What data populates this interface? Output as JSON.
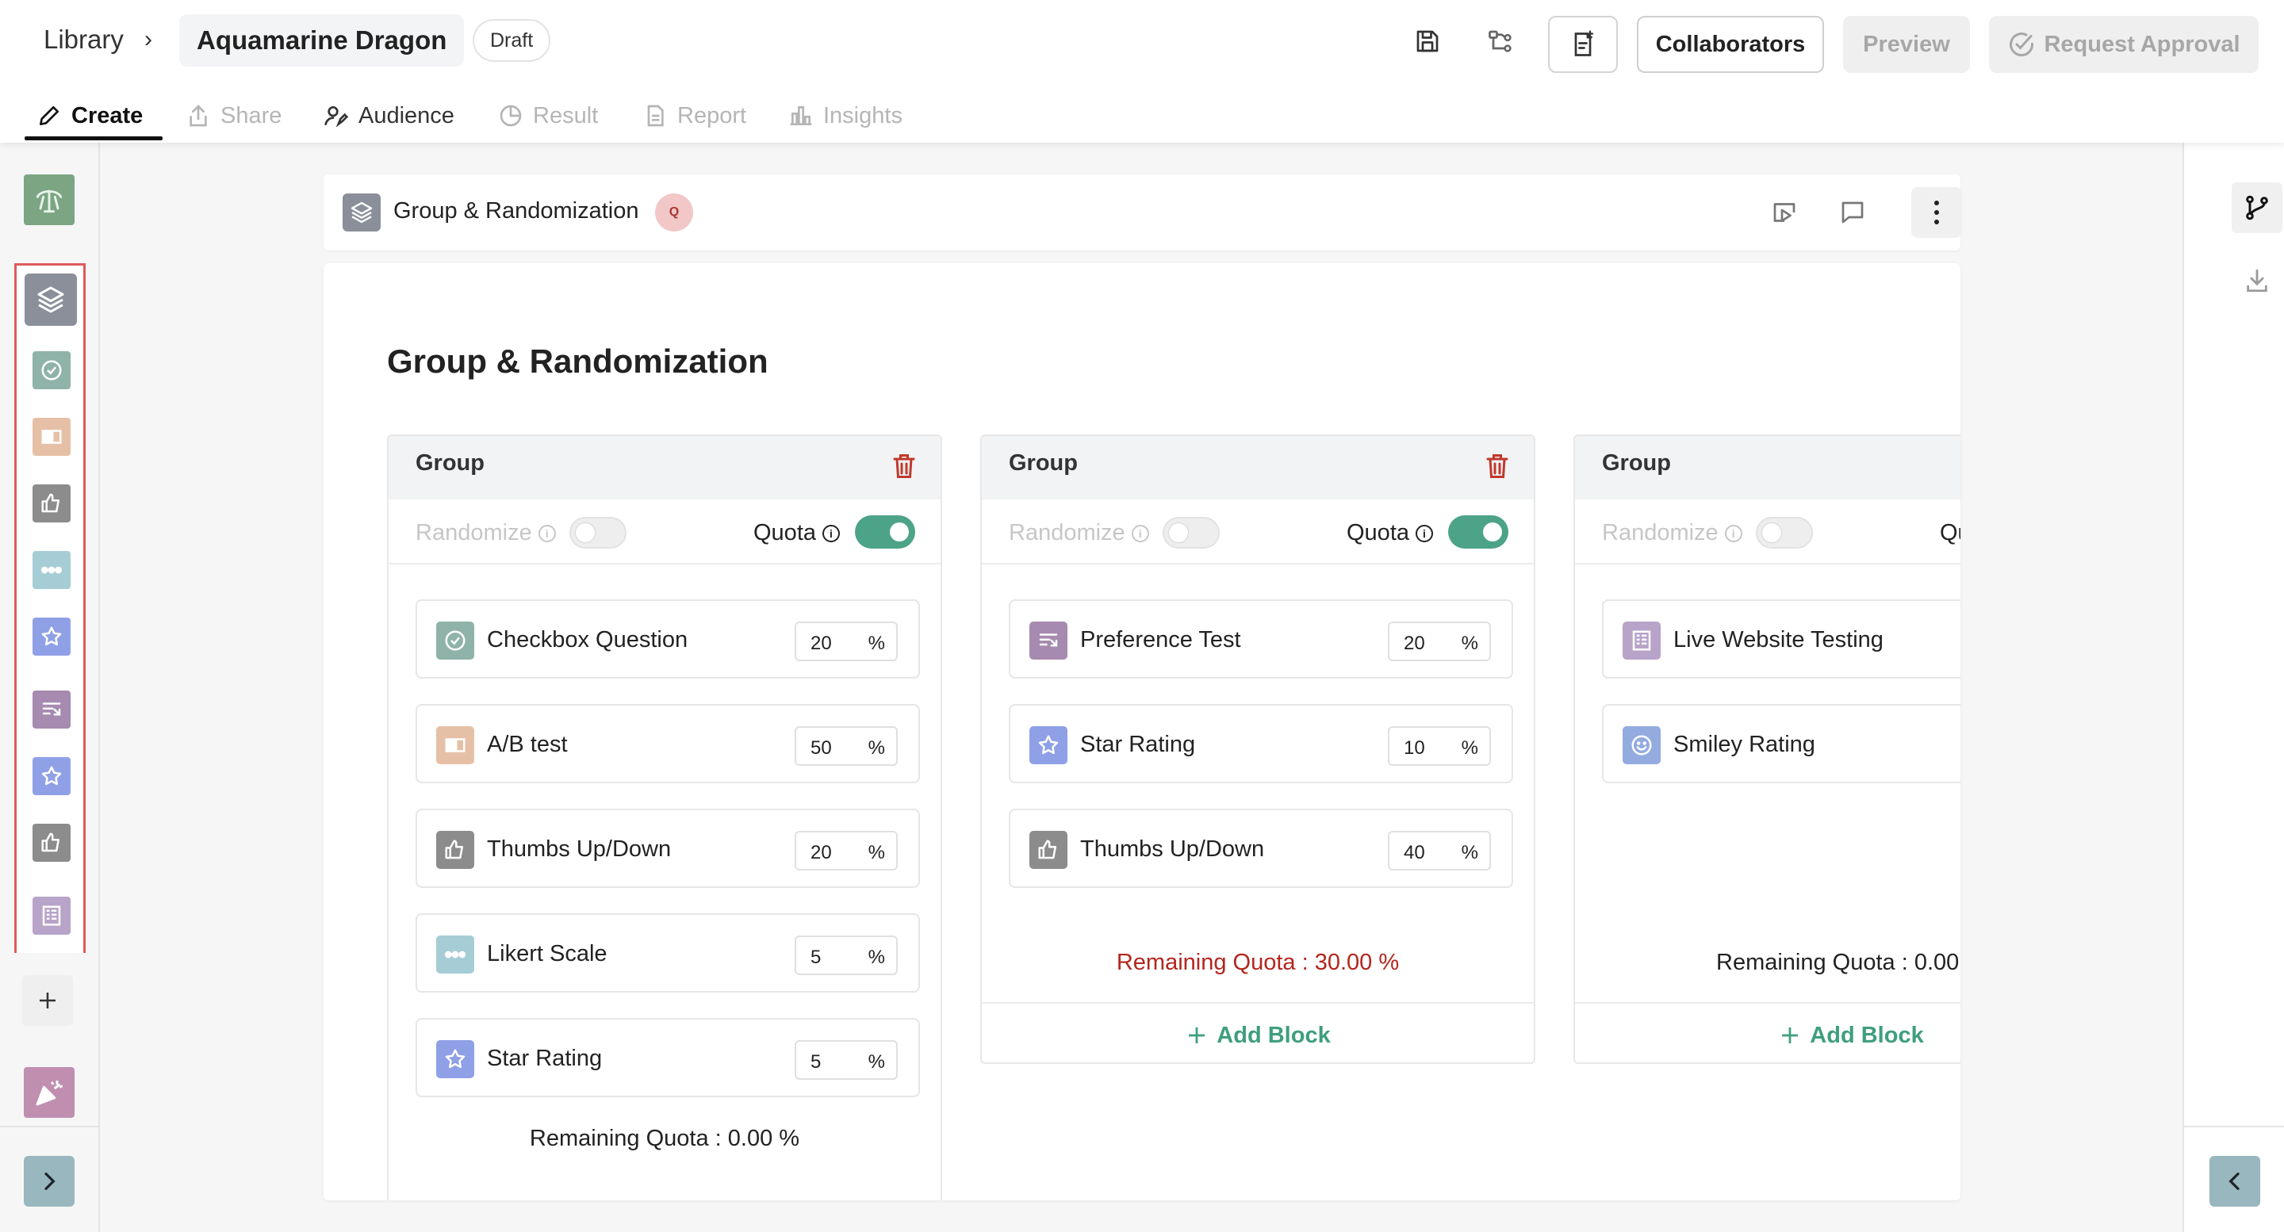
{
  "header": {
    "breadcrumb_library": "Library",
    "breadcrumb_separator": "›",
    "title": "Aquamarine Dragon",
    "status_badge": "Draft",
    "collaborators_label": "Collaborators",
    "preview_label": "Preview",
    "request_approval_label": "Request Approval"
  },
  "tabs": [
    {
      "label": "Create",
      "icon": "pencil-icon",
      "active": true
    },
    {
      "label": "Share",
      "icon": "share-icon",
      "active": false
    },
    {
      "label": "Audience",
      "icon": "audience-icon",
      "active": false
    },
    {
      "label": "Result",
      "icon": "pie-chart-icon",
      "active": false
    },
    {
      "label": "Report",
      "icon": "document-icon",
      "active": false
    },
    {
      "label": "Insights",
      "icon": "bar-chart-icon",
      "active": false
    }
  ],
  "block_header": {
    "title": "Group & Randomization",
    "badge": "Q"
  },
  "card": {
    "title": "Group & Randomization"
  },
  "groups": [
    {
      "name": "Group",
      "randomize_label": "Randomize",
      "quota_label": "Quota",
      "randomize_on": false,
      "quota_on": true,
      "items": [
        {
          "name": "Checkbox Question",
          "quota": "20",
          "unit": "%",
          "icon": "checkbox-icon",
          "color": "#8fb3a8"
        },
        {
          "name": "A/B test",
          "quota": "50",
          "unit": "%",
          "icon": "ab-test-icon",
          "color": "#e6c0a6"
        },
        {
          "name": "Thumbs Up/Down",
          "quota": "20",
          "unit": "%",
          "icon": "thumbs-up-icon",
          "color": "#8c8c8c"
        },
        {
          "name": "Likert Scale",
          "quota": "5",
          "unit": "%",
          "icon": "likert-icon",
          "color": "#a6cdd6"
        },
        {
          "name": "Star Rating",
          "quota": "5",
          "unit": "%",
          "icon": "star-icon",
          "color": "#8fa0e6"
        }
      ],
      "remaining": "Remaining Quota : 0.00 %"
    },
    {
      "name": "Group",
      "randomize_label": "Randomize",
      "quota_label": "Quota",
      "randomize_on": false,
      "quota_on": true,
      "items": [
        {
          "name": "Preference Test",
          "quota": "20",
          "unit": "%",
          "icon": "preference-icon",
          "color": "#a68aaf"
        },
        {
          "name": "Star Rating",
          "quota": "10",
          "unit": "%",
          "icon": "star-icon",
          "color": "#8fa0e6"
        },
        {
          "name": "Thumbs Up/Down",
          "quota": "40",
          "unit": "%",
          "icon": "thumbs-up-icon",
          "color": "#8c8c8c"
        }
      ],
      "remaining": "Remaining Quota : 30.00 %",
      "add_block": "Add Block"
    },
    {
      "name": "Group",
      "randomize_label": "Randomize",
      "quota_label": "Qu",
      "randomize_on": false,
      "items": [
        {
          "name": "Live Website Testing",
          "icon": "website-test-icon",
          "color": "#b8a3c9"
        },
        {
          "name": "Smiley Rating",
          "icon": "smiley-icon",
          "color": "#94abe0"
        }
      ],
      "remaining": "Remaining Quota : 0.00",
      "add_block": "Add Block"
    }
  ],
  "colors": {
    "accent_green": "#4ca388",
    "danger_red": "#b3261e",
    "rail_highlight": "#e05a5a"
  }
}
